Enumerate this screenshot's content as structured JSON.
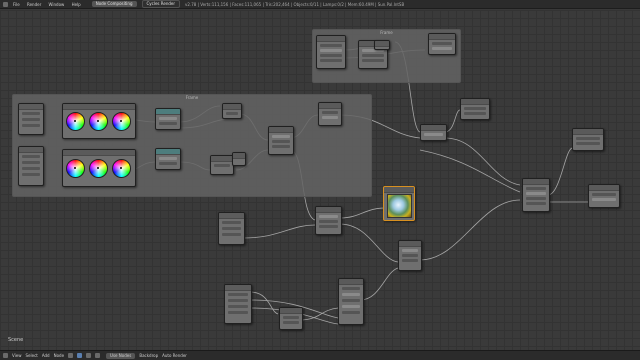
{
  "topbar": {
    "menu": [
      "File",
      "Render",
      "Window",
      "Help"
    ],
    "layout": "Node Compositing",
    "engine": "Cycles Render",
    "stats": "v2.78 | Verts:111,156 | Faces:111,065 | Tris:202,464 | Objects:0/11 | Lamps:0/2 | Mem:60.49M | Sun.Pal.IntSB"
  },
  "scene_label": "Scene",
  "frames": [
    {
      "label": "Frame"
    },
    {
      "label": "Frame"
    }
  ],
  "bottombar": {
    "items": [
      "View",
      "Select",
      "Add",
      "Node"
    ],
    "use_nodes": "Use Nodes",
    "backdrop": "Backdrop",
    "auto_render": "Auto Render"
  },
  "colors": {
    "background": "#393939",
    "node_body": "#6f6f6f",
    "frame": "#646464",
    "wire": "#b8b8b8",
    "socket_image": "#c8c840",
    "socket_value": "#a0a0a0"
  }
}
